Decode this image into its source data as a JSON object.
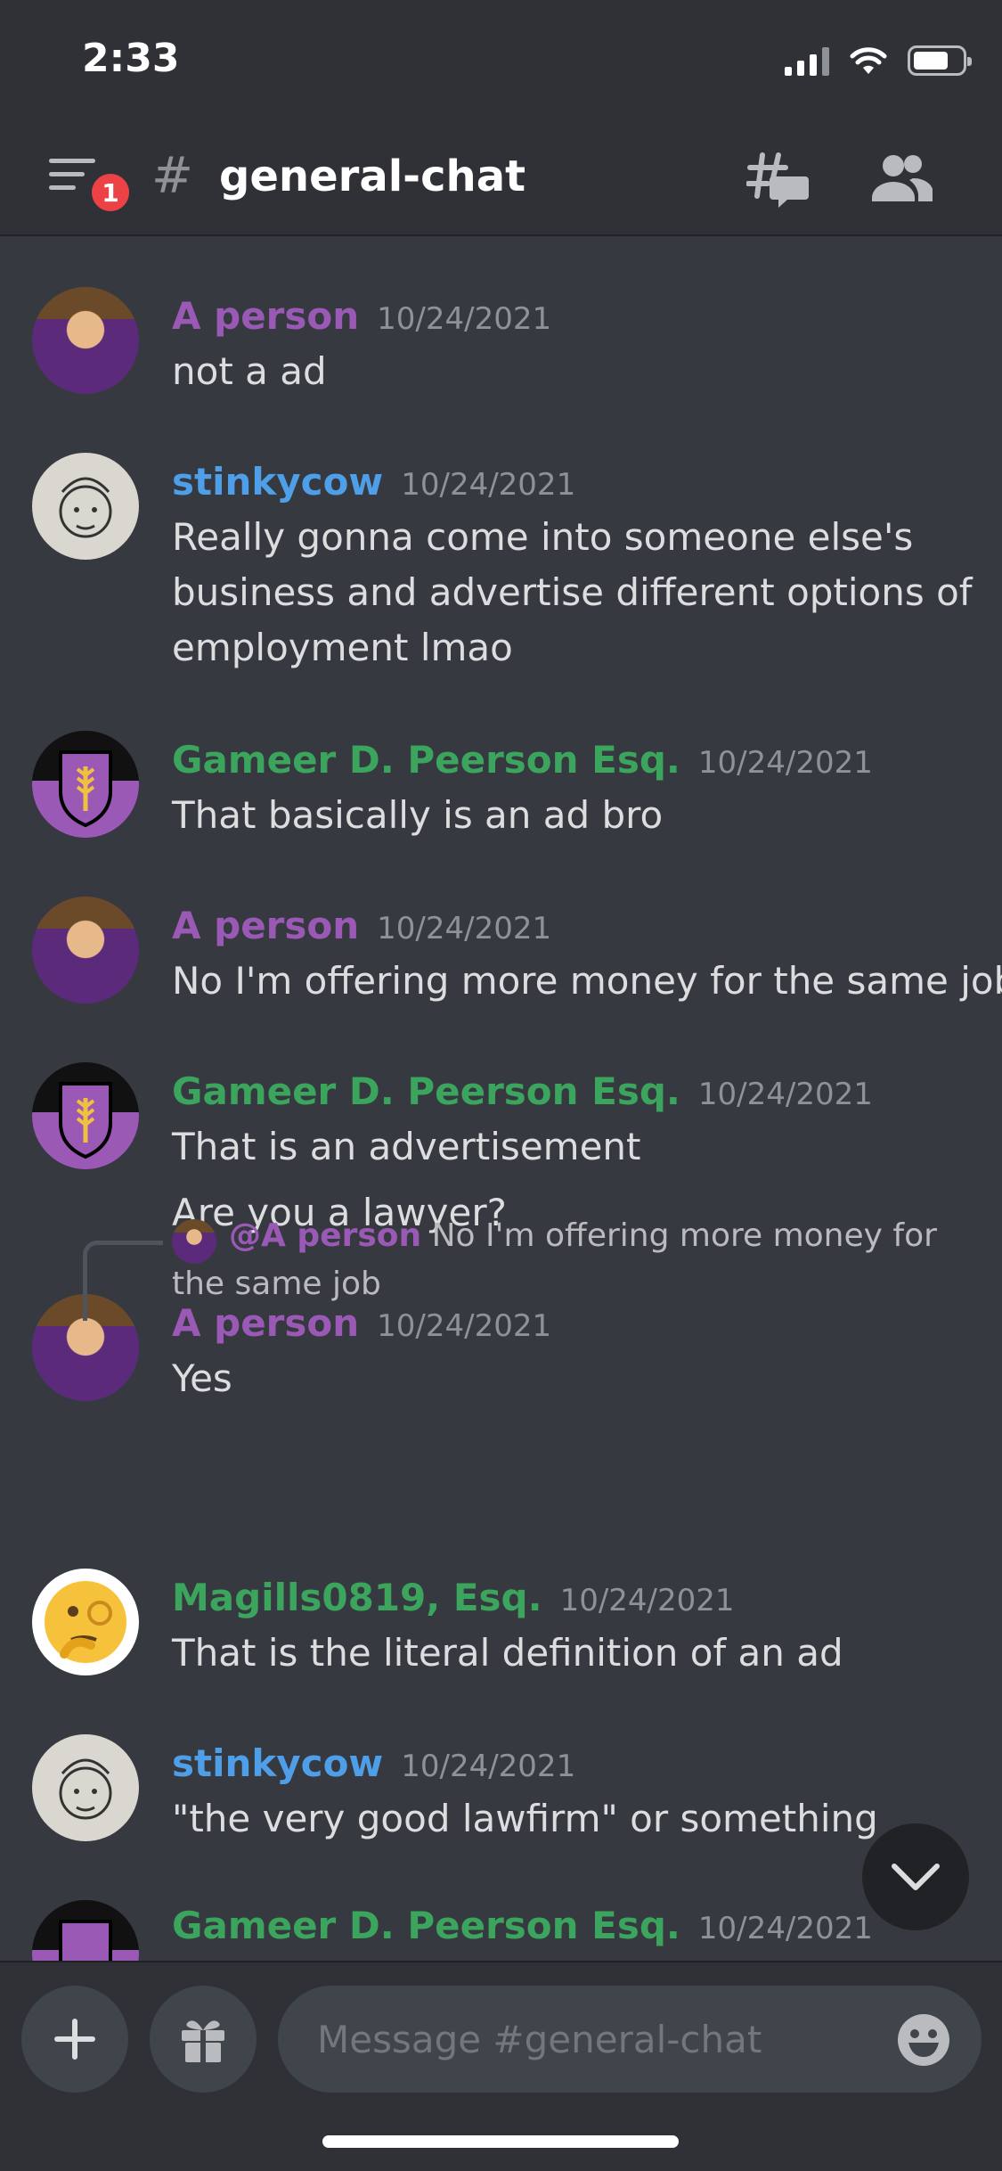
{
  "status_bar": {
    "time": "2:33"
  },
  "header": {
    "notification_count": "1",
    "hash": "#",
    "channel_name": "general-chat"
  },
  "messages": [
    {
      "author": "A person",
      "timestamp": "10/24/2021",
      "lines": [
        "not a ad"
      ],
      "author_color": "#9b59b6"
    },
    {
      "author": "stinkycow",
      "timestamp": "10/24/2021",
      "lines": [
        "Really gonna come into someone else's business and advertise different options of employment lmao"
      ],
      "author_color": "#4f9ee8"
    },
    {
      "author": "Gameer D. Peerson Esq.",
      "timestamp": "10/24/2021",
      "lines": [
        "That basically is an ad bro"
      ],
      "author_color": "#3ba55d"
    },
    {
      "author": "A person",
      "timestamp": "10/24/2021",
      "lines": [
        "No I'm offering more money for the same job"
      ],
      "author_color": "#9b59b6"
    },
    {
      "author": "Gameer D. Peerson Esq.",
      "timestamp": "10/24/2021",
      "lines": [
        "That is an advertisement",
        "Are you a lawyer?"
      ],
      "author_color": "#3ba55d"
    },
    {
      "author": "A person",
      "timestamp": "10/24/2021",
      "lines": [
        "Yes"
      ],
      "author_color": "#9b59b6"
    },
    {
      "reply": {
        "mention": "@A person",
        "text": "No I'm offering more money for the same job"
      },
      "author": "Magills0819, Esq.",
      "timestamp": "10/24/2021",
      "lines": [
        "That is the literal definition of an ad"
      ],
      "author_color": "#3ba55d"
    },
    {
      "author": "stinkycow",
      "timestamp": "10/24/2021",
      "lines": [
        "\"the very good lawfirm\" or something"
      ],
      "author_color": "#4f9ee8"
    },
    {
      "author": "Gameer D. Peerson Esq.",
      "timestamp": "10/24/2021",
      "lines": [],
      "author_color": "#3ba55d"
    }
  ],
  "composer": {
    "placeholder": "Message #general-chat"
  },
  "icons": {
    "menu": "hamburger-icon",
    "threads": "threads-icon",
    "members": "members-icon",
    "plus": "plus-icon",
    "gift": "gift-icon",
    "emoji": "emoji-icon",
    "jump": "chevron-down-icon"
  }
}
